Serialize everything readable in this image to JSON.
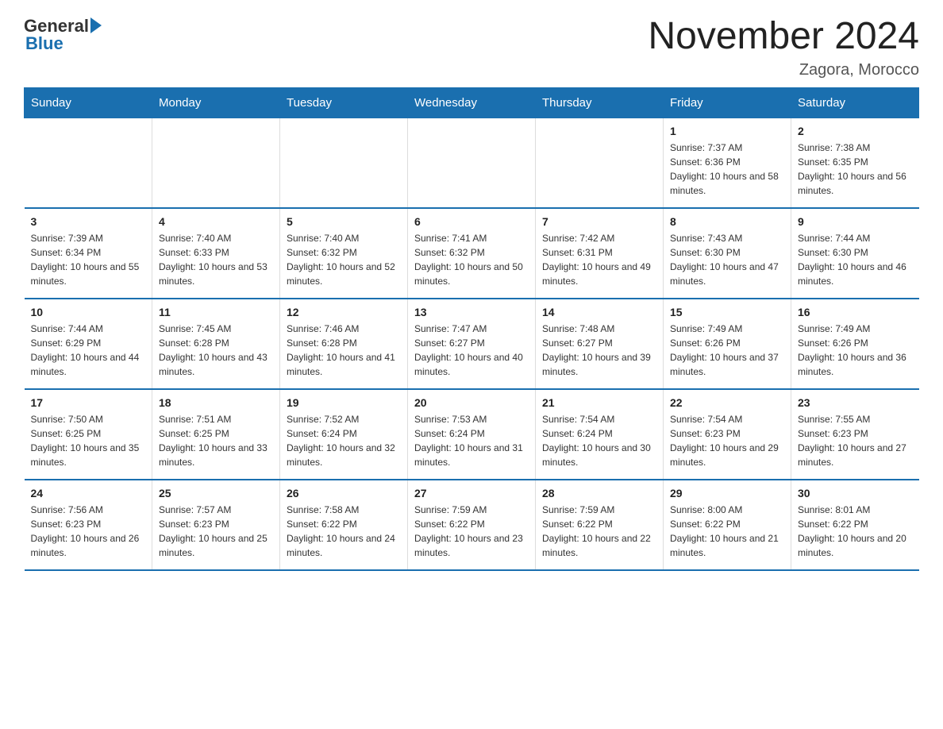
{
  "header": {
    "title": "November 2024",
    "location": "Zagora, Morocco",
    "logo_general": "General",
    "logo_blue": "Blue"
  },
  "weekdays": [
    "Sunday",
    "Monday",
    "Tuesday",
    "Wednesday",
    "Thursday",
    "Friday",
    "Saturday"
  ],
  "weeks": [
    {
      "days": [
        {
          "number": "",
          "info": ""
        },
        {
          "number": "",
          "info": ""
        },
        {
          "number": "",
          "info": ""
        },
        {
          "number": "",
          "info": ""
        },
        {
          "number": "",
          "info": ""
        },
        {
          "number": "1",
          "info": "Sunrise: 7:37 AM\nSunset: 6:36 PM\nDaylight: 10 hours and 58 minutes."
        },
        {
          "number": "2",
          "info": "Sunrise: 7:38 AM\nSunset: 6:35 PM\nDaylight: 10 hours and 56 minutes."
        }
      ]
    },
    {
      "days": [
        {
          "number": "3",
          "info": "Sunrise: 7:39 AM\nSunset: 6:34 PM\nDaylight: 10 hours and 55 minutes."
        },
        {
          "number": "4",
          "info": "Sunrise: 7:40 AM\nSunset: 6:33 PM\nDaylight: 10 hours and 53 minutes."
        },
        {
          "number": "5",
          "info": "Sunrise: 7:40 AM\nSunset: 6:32 PM\nDaylight: 10 hours and 52 minutes."
        },
        {
          "number": "6",
          "info": "Sunrise: 7:41 AM\nSunset: 6:32 PM\nDaylight: 10 hours and 50 minutes."
        },
        {
          "number": "7",
          "info": "Sunrise: 7:42 AM\nSunset: 6:31 PM\nDaylight: 10 hours and 49 minutes."
        },
        {
          "number": "8",
          "info": "Sunrise: 7:43 AM\nSunset: 6:30 PM\nDaylight: 10 hours and 47 minutes."
        },
        {
          "number": "9",
          "info": "Sunrise: 7:44 AM\nSunset: 6:30 PM\nDaylight: 10 hours and 46 minutes."
        }
      ]
    },
    {
      "days": [
        {
          "number": "10",
          "info": "Sunrise: 7:44 AM\nSunset: 6:29 PM\nDaylight: 10 hours and 44 minutes."
        },
        {
          "number": "11",
          "info": "Sunrise: 7:45 AM\nSunset: 6:28 PM\nDaylight: 10 hours and 43 minutes."
        },
        {
          "number": "12",
          "info": "Sunrise: 7:46 AM\nSunset: 6:28 PM\nDaylight: 10 hours and 41 minutes."
        },
        {
          "number": "13",
          "info": "Sunrise: 7:47 AM\nSunset: 6:27 PM\nDaylight: 10 hours and 40 minutes."
        },
        {
          "number": "14",
          "info": "Sunrise: 7:48 AM\nSunset: 6:27 PM\nDaylight: 10 hours and 39 minutes."
        },
        {
          "number": "15",
          "info": "Sunrise: 7:49 AM\nSunset: 6:26 PM\nDaylight: 10 hours and 37 minutes."
        },
        {
          "number": "16",
          "info": "Sunrise: 7:49 AM\nSunset: 6:26 PM\nDaylight: 10 hours and 36 minutes."
        }
      ]
    },
    {
      "days": [
        {
          "number": "17",
          "info": "Sunrise: 7:50 AM\nSunset: 6:25 PM\nDaylight: 10 hours and 35 minutes."
        },
        {
          "number": "18",
          "info": "Sunrise: 7:51 AM\nSunset: 6:25 PM\nDaylight: 10 hours and 33 minutes."
        },
        {
          "number": "19",
          "info": "Sunrise: 7:52 AM\nSunset: 6:24 PM\nDaylight: 10 hours and 32 minutes."
        },
        {
          "number": "20",
          "info": "Sunrise: 7:53 AM\nSunset: 6:24 PM\nDaylight: 10 hours and 31 minutes."
        },
        {
          "number": "21",
          "info": "Sunrise: 7:54 AM\nSunset: 6:24 PM\nDaylight: 10 hours and 30 minutes."
        },
        {
          "number": "22",
          "info": "Sunrise: 7:54 AM\nSunset: 6:23 PM\nDaylight: 10 hours and 29 minutes."
        },
        {
          "number": "23",
          "info": "Sunrise: 7:55 AM\nSunset: 6:23 PM\nDaylight: 10 hours and 27 minutes."
        }
      ]
    },
    {
      "days": [
        {
          "number": "24",
          "info": "Sunrise: 7:56 AM\nSunset: 6:23 PM\nDaylight: 10 hours and 26 minutes."
        },
        {
          "number": "25",
          "info": "Sunrise: 7:57 AM\nSunset: 6:23 PM\nDaylight: 10 hours and 25 minutes."
        },
        {
          "number": "26",
          "info": "Sunrise: 7:58 AM\nSunset: 6:22 PM\nDaylight: 10 hours and 24 minutes."
        },
        {
          "number": "27",
          "info": "Sunrise: 7:59 AM\nSunset: 6:22 PM\nDaylight: 10 hours and 23 minutes."
        },
        {
          "number": "28",
          "info": "Sunrise: 7:59 AM\nSunset: 6:22 PM\nDaylight: 10 hours and 22 minutes."
        },
        {
          "number": "29",
          "info": "Sunrise: 8:00 AM\nSunset: 6:22 PM\nDaylight: 10 hours and 21 minutes."
        },
        {
          "number": "30",
          "info": "Sunrise: 8:01 AM\nSunset: 6:22 PM\nDaylight: 10 hours and 20 minutes."
        }
      ]
    }
  ]
}
